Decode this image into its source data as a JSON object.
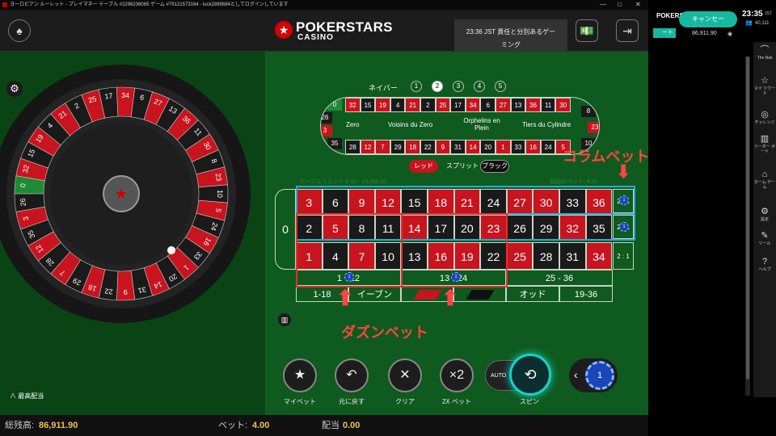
{
  "window_title": "ヨーロピアン ルーレット - プレイマネー テーブル #2296236065 ゲーム #79121573164 - luck2889684としてログインしています",
  "brand": {
    "line1": "POKERSTARS",
    "line2": "CASINO"
  },
  "notice": {
    "line1": "23:36 JST 責任と分別あるゲー",
    "line2": "ミング"
  },
  "neighbors": {
    "label": "ネイバー",
    "options": [
      "1",
      "2",
      "3",
      "4",
      "5"
    ],
    "selected": "2"
  },
  "racetrack": {
    "top": [
      "32",
      "15",
      "19",
      "4",
      "21",
      "2",
      "25",
      "17",
      "34",
      "6",
      "27",
      "13",
      "36",
      "11",
      "30"
    ],
    "bottom": [
      "28",
      "12",
      "7",
      "29",
      "18",
      "22",
      "9",
      "31",
      "14",
      "20",
      "1",
      "33",
      "16",
      "24",
      "5"
    ],
    "left": [
      "0",
      "26",
      "3",
      "35"
    ],
    "right": [
      "8",
      "23",
      "10"
    ],
    "sections": [
      "Zero",
      "Voisins du Zero",
      "Orphelins en Plein",
      "Tiers du Cylindre"
    ]
  },
  "toggle": {
    "red": "レッド",
    "split": "スプリット",
    "black": "ブラック"
  },
  "table_limit": "テーブルリミット 0.10 - 10,000.00",
  "previous": "前回のベット: 4.00",
  "grid": {
    "zero": "0",
    "rows": [
      [
        [
          "3",
          "r"
        ],
        [
          "6",
          "b"
        ],
        [
          "9",
          "r"
        ],
        [
          "12",
          "r"
        ],
        [
          "15",
          "b"
        ],
        [
          "18",
          "r"
        ],
        [
          "21",
          "r"
        ],
        [
          "24",
          "b"
        ],
        [
          "27",
          "r"
        ],
        [
          "30",
          "r"
        ],
        [
          "33",
          "b"
        ],
        [
          "36",
          "r"
        ]
      ],
      [
        [
          "2",
          "b"
        ],
        [
          "5",
          "r"
        ],
        [
          "8",
          "b"
        ],
        [
          "11",
          "b"
        ],
        [
          "14",
          "r"
        ],
        [
          "17",
          "b"
        ],
        [
          "20",
          "b"
        ],
        [
          "23",
          "r"
        ],
        [
          "26",
          "b"
        ],
        [
          "29",
          "b"
        ],
        [
          "32",
          "r"
        ],
        [
          "35",
          "b"
        ]
      ],
      [
        [
          "1",
          "r"
        ],
        [
          "4",
          "b"
        ],
        [
          "7",
          "r"
        ],
        [
          "10",
          "b"
        ],
        [
          "13",
          "b"
        ],
        [
          "16",
          "r"
        ],
        [
          "19",
          "r"
        ],
        [
          "22",
          "b"
        ],
        [
          "25",
          "r"
        ],
        [
          "28",
          "b"
        ],
        [
          "31",
          "b"
        ],
        [
          "34",
          "r"
        ]
      ]
    ],
    "column_labels": [
      "2 : 1",
      "2 : 1",
      "2 : 1"
    ],
    "dozens": [
      "1 - 12",
      "13 - 24",
      "25 - 36"
    ],
    "even_money": [
      "1-18",
      "イーブン",
      "",
      "",
      "オッド",
      "19-36"
    ]
  },
  "chips": {
    "value": "1"
  },
  "annotations": {
    "column": "コラムベット",
    "dozen": "ダズンベット"
  },
  "wheel": {
    "numbers": [
      "0",
      "32",
      "15",
      "19",
      "4",
      "21",
      "2",
      "25",
      "17",
      "34",
      "6",
      "27",
      "13",
      "36",
      "11",
      "30",
      "8",
      "23",
      "10",
      "5",
      "24",
      "16",
      "33",
      "1",
      "20",
      "14",
      "31",
      "9",
      "22",
      "18",
      "29",
      "7",
      "28",
      "12",
      "35",
      "3",
      "26"
    ]
  },
  "dock": {
    "my_bet": "マイベット",
    "undo": "元に戻す",
    "clear": "クリア",
    "double": "2X ベット",
    "double_icon": "×2",
    "auto": "AUTO",
    "spin": "スピン",
    "chip_value": "1"
  },
  "high_limits": "最高配当",
  "footer": {
    "balance_label": "総残高:",
    "balance": "86,911.90",
    "bet_label": "ベット:",
    "bet": "4.00",
    "payout_label": "配当",
    "payout": "0.00"
  },
  "right": {
    "logo": "POKERSTARS",
    "cancel": "キャンセー",
    "green_label": "ート",
    "balance": "86,911.90",
    "time": "23:35",
    "time_suffix": "JST",
    "players": "40,111",
    "nav": [
      {
        "icon": "rail-icon",
        "label": "The Rail"
      },
      {
        "icon": "star-icon",
        "label": "マイ リワード"
      },
      {
        "icon": "target-icon",
        "label": "チャレンジ"
      },
      {
        "icon": "chart-icon",
        "label": "リーダー ボード"
      },
      {
        "icon": "home-icon",
        "label": "ホーム ゲーム"
      },
      {
        "icon": "gear-icon",
        "label": "設定"
      },
      {
        "icon": "wrench-icon",
        "label": "ツール"
      },
      {
        "icon": "help-icon",
        "label": "ヘルプ"
      }
    ]
  }
}
